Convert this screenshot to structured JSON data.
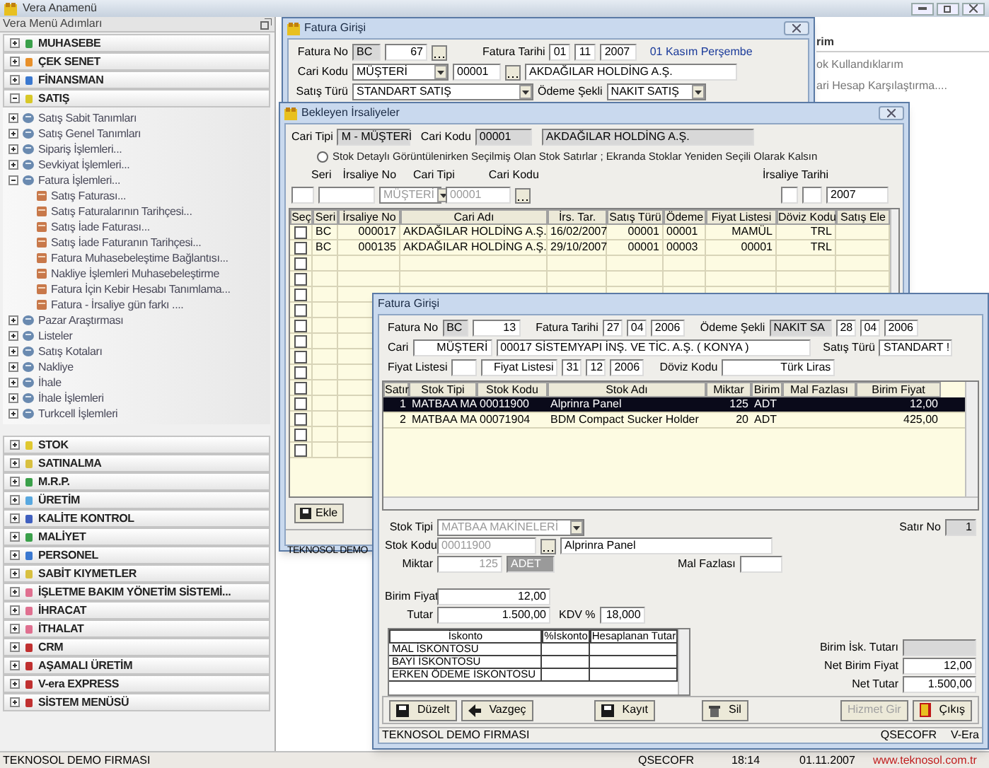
{
  "app": {
    "title": "Vera Anamenü"
  },
  "sidebar": {
    "header": "Vera Menü Adımları",
    "modules": [
      {
        "label": "MUHASEBE",
        "color": "#3aa04a",
        "expanded": false
      },
      {
        "label": "ÇEK SENET",
        "color": "#e8902a",
        "expanded": false
      },
      {
        "label": "FİNANSMAN",
        "color": "#3a78d0",
        "expanded": false
      },
      {
        "label": "SATIŞ",
        "color": "#d8c828",
        "expanded": true,
        "children": [
          {
            "label": "Satış Sabit Tanımları",
            "expanded": false
          },
          {
            "label": "Satış Genel Tanımları",
            "expanded": false
          },
          {
            "label": "Sipariş İşlemleri...",
            "expanded": false
          },
          {
            "label": "Sevkiyat İşlemleri...",
            "expanded": false
          },
          {
            "label": "Fatura İşlemleri...",
            "expanded": true,
            "children": [
              {
                "label": "Satış Faturası..."
              },
              {
                "label": "Satış Faturalarının Tarihçesi..."
              },
              {
                "label": "Satış İade Faturası..."
              },
              {
                "label": "Satış İade Faturanın Tarihçesi..."
              },
              {
                "label": "Fatura Muhasebeleştime Bağlantısı..."
              },
              {
                "label": "Nakliye İşlemleri Muhasebeleştirme"
              },
              {
                "label": "Fatura İçin Kebir Hesabı Tanımlama..."
              },
              {
                "label": "Fatura - İrsaliye gün farkı ...."
              }
            ]
          },
          {
            "label": "Pazar Araştırması",
            "expanded": false
          },
          {
            "label": "Listeler",
            "expanded": false
          },
          {
            "label": "Satış Kotaları",
            "expanded": false
          },
          {
            "label": "Nakliye",
            "expanded": false
          },
          {
            "label": "İhale",
            "expanded": false
          },
          {
            "label": "İhale İşlemleri",
            "expanded": false
          },
          {
            "label": "Turkcell İşlemleri",
            "expanded": false
          }
        ]
      },
      {
        "label": "STOK",
        "color": "#e0c830",
        "expanded": false
      },
      {
        "label": "SATINALMA",
        "color": "#d8c040",
        "expanded": false
      },
      {
        "label": "M.R.P.",
        "color": "#3aa04a",
        "expanded": false
      },
      {
        "label": "ÜRETİM",
        "color": "#58a8e0",
        "expanded": false
      },
      {
        "label": "KALİTE KONTROL",
        "color": "#4060c0",
        "expanded": false
      },
      {
        "label": "MALİYET",
        "color": "#3aa04a",
        "expanded": false
      },
      {
        "label": "PERSONEL",
        "color": "#3a78d0",
        "expanded": false
      },
      {
        "label": "SABİT KIYMETLER",
        "color": "#d8c040",
        "expanded": false
      },
      {
        "label": "İŞLETME BAKIM YÖNETİM SİSTEMİ...",
        "color": "#e07090",
        "expanded": false
      },
      {
        "label": "İHRACAT",
        "color": "#e07090",
        "expanded": false
      },
      {
        "label": "İTHALAT",
        "color": "#e07090",
        "expanded": false
      },
      {
        "label": "CRM",
        "color": "#c03030",
        "expanded": false
      },
      {
        "label": "AŞAMALI ÜRETİM",
        "color": "#c03030",
        "expanded": false
      },
      {
        "label": "V-era EXPRESS",
        "color": "#c03030",
        "expanded": false
      },
      {
        "label": "SİSTEM MENÜSÜ",
        "color": "#c03030",
        "expanded": false
      }
    ]
  },
  "background_panel": {
    "heading": "rim",
    "items": [
      "ok Kullandıklarım",
      "ari Hesap Karşılaştırma...."
    ]
  },
  "invoice_back": {
    "title": "Fatura Girişi",
    "fatura_no_label": "Fatura No",
    "fatura_no": [
      "BC",
      "67"
    ],
    "fatura_tarihi_label": "Fatura Tarihi",
    "fatura_tarihi": [
      "01",
      "11",
      "2007"
    ],
    "day_text": "01 Kasım Perşembe",
    "cari_kodu_label": "Cari Kodu",
    "cari_tipi": "MÜŞTERİ",
    "cari_kodu": "00001",
    "cari_adi": "AKDAĞILAR  HOLDİNG A.Ş.",
    "satis_turu_label": "Satış Türü",
    "satis_turu": "STANDART SATIŞ",
    "odeme_label": "Ödeme Şekli",
    "odeme": "NAKIT SATIŞ"
  },
  "waiting_dispatches": {
    "title": "Bekleyen İrsaliyeler",
    "cari_tipi_label": "Cari Tipi",
    "cari_tipi": "M - MÜŞTERİ",
    "cari_kodu_label": "Cari Kodu",
    "cari_kodu": "00001",
    "cari_adi": "AKDAĞILAR  HOLDİNG A.Ş.",
    "option": {
      "text": "Stok Detaylı Görüntülenirken Seçilmiş Olan Stok Satırlar ; Ekranda Stoklar Yeniden Seçili Olarak Kalsın",
      "selected": false
    },
    "filter_labels": [
      "Seri",
      "İrsaliye No",
      "Cari Tipi",
      "Cari Kodu",
      "İrsaliye Tarihi"
    ],
    "filter_cari_tipi": {
      "value": "MÜŞTERİ",
      "disabled": true
    },
    "filter_cari_kodu": {
      "value": "00001",
      "disabled": true
    },
    "filter_year": "2007",
    "columns": [
      "Seç",
      "Seri",
      "İrsaliye No",
      "Cari Adı",
      "İrs. Tar.",
      "Satış Türü",
      "Ödeme",
      "Fiyat Listesi",
      "Döviz Kodu",
      "Satış Ele"
    ],
    "rows": [
      {
        "checked": false,
        "cells": [
          "BC",
          "000017",
          "AKDAĞILAR  HOLDİNG A.Ş.",
          "16/02/2007",
          "00001",
          "00001",
          "MAMÜL",
          "TRL"
        ]
      },
      {
        "checked": false,
        "cells": [
          "BC",
          "000135",
          "AKDAĞILAR  HOLDİNG A.Ş.",
          "29/10/2007",
          "00001",
          "00003",
          "00001",
          "TRL"
        ]
      },
      {
        "checked": false
      },
      {
        "checked": false
      },
      {
        "checked": false
      },
      {
        "checked": false
      },
      {
        "checked": false
      },
      {
        "checked": false
      },
      {
        "checked": false
      },
      {
        "checked": false
      },
      {
        "checked": false
      },
      {
        "checked": false
      },
      {
        "checked": false
      },
      {
        "checked": false
      },
      {
        "checked": false
      }
    ],
    "add_button": "Ekle",
    "status": "TEKNOSOL DEMO"
  },
  "invoice_front": {
    "title": "Fatura Girişi",
    "fatura_no_label": "Fatura No",
    "fatura_no": [
      "BC",
      "13"
    ],
    "fatura_tarihi_label": "Fatura Tarihi",
    "fatura_tarihi": [
      "27",
      "04",
      "2006"
    ],
    "cari_label": "Cari",
    "cari_tipi": "MÜŞTERİ",
    "cari": "00017 SİSTEMYAPI İNŞ. VE TİC. A.Ş. ( KONYA )",
    "odeme_label": "Ödeme Şekli",
    "odeme": "NAKIT SA",
    "odeme_tarihi": [
      "28",
      "04",
      "2006"
    ],
    "satis_turu_label": "Satış Türü",
    "satis_turu": "STANDART !",
    "fiyat_listesi_label": "Fiyat Listesi",
    "fiyat_listesi_name": "Fiyat Listesi",
    "fiyat_listesi_tarihi": [
      "31",
      "12",
      "2006"
    ],
    "doviz_label": "Döviz Kodu",
    "doviz": "Türk Liras",
    "columns": [
      "Satır",
      "Stok Tipi",
      "Stok Kodu",
      "Stok Adı",
      "Miktar",
      "Birim",
      "Mal Fazlası",
      "Birim Fiyat"
    ],
    "rows": [
      {
        "selected": true,
        "cells": [
          "1",
          "MATBAA MA",
          "00011900",
          "Alprinra Panel",
          "125",
          "ADT",
          "",
          "12,00"
        ]
      },
      {
        "selected": false,
        "cells": [
          "2",
          "MATBAA MA",
          "00071904",
          "BDM Compact Sucker Holder",
          "20",
          "ADT",
          "",
          "425,00"
        ]
      }
    ],
    "stok_tipi_label": "Stok Tipi",
    "stok_tipi": {
      "value": "MATBAA MAKİNELERİ",
      "disabled": true
    },
    "satir_no_label": "Satır No",
    "satir_no": "1",
    "stok_kodu_label": "Stok Kodu",
    "stok_kodu": {
      "value": "00011900",
      "disabled": true
    },
    "stok_adi": "Alprinra Panel",
    "miktar_label": "Miktar",
    "miktar": {
      "value": "125",
      "disabled": true
    },
    "birim": "ADET",
    "mal_fazlasi_label": "Mal Fazlası",
    "birim_fiyat_label": "Birim Fiyat",
    "birim_fiyat": "12,00",
    "tutar_label": "Tutar",
    "tutar": "1.500,00",
    "kdv_label": "KDV %",
    "kdv": "18,000",
    "discount_columns": [
      "İskonto",
      "%İskonto",
      "Hesaplanan Tutar"
    ],
    "discounts": [
      "MAL İSKONTOSU",
      "BAYİ İSKONTOSU",
      "ERKEN ÖDEME İSKONTOSU"
    ],
    "totals": [
      {
        "label": "Birim İsk. Tutarı"
      },
      {
        "label": "Net Birim Fiyat",
        "value": "12,00"
      },
      {
        "label": "Net Tutar",
        "value": "1.500,00"
      }
    ],
    "buttons": [
      {
        "kind": "edit",
        "label": "Düzelt",
        "disabled": false
      },
      {
        "kind": "cancel",
        "label": "Vazgeç",
        "disabled": false
      },
      {
        "kind": "save",
        "label": "Kayıt",
        "disabled": false
      },
      {
        "kind": "delete",
        "label": "Sil",
        "disabled": false
      },
      {
        "kind": "service",
        "label": "Hizmet Gir",
        "disabled": true
      },
      {
        "kind": "exit",
        "label": "Çıkış",
        "disabled": false
      }
    ],
    "status": [
      "TEKNOSOL DEMO FIRMASI",
      "QSECOFR",
      "V-Era"
    ]
  },
  "status_bar": {
    "company": "TEKNOSOL DEMO FIRMASI",
    "user": "QSECOFR",
    "time": "18:14",
    "date": "01.11.2007",
    "website": "www.teknosol.com.tr"
  }
}
